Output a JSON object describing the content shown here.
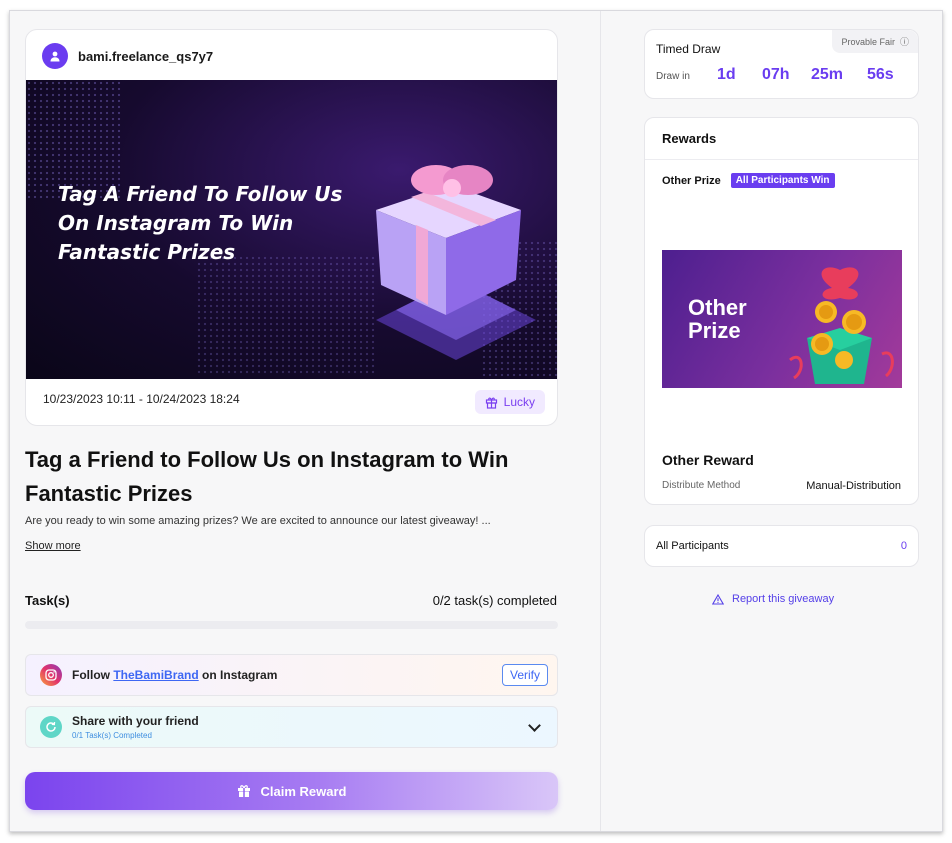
{
  "giveaway": {
    "username": "bami.freelance_qs7y7",
    "banner_text": "Tag A Friend To Follow Us On Instagram To Win Fantastic Prizes",
    "date_range": "10/23/2023 10:11 - 10/24/2023 18:24",
    "badge": "Lucky",
    "title": "Tag a Friend to Follow Us on Instagram to Win Fantastic Prizes",
    "description": "Are you ready to win some amazing prizes? We are excited to announce our latest giveaway! ...",
    "show_more": "Show more"
  },
  "tasks": {
    "label": "Task(s)",
    "completed_text": "0/2 task(s) completed",
    "progress_fraction": 0,
    "items": [
      {
        "prefix": "Follow",
        "link": "TheBamiBrand",
        "suffix": "on Instagram",
        "action": "Verify"
      },
      {
        "label": "Share with your friend",
        "sub": "0/1 Task(s) Completed"
      }
    ]
  },
  "claim_button": "Claim Reward",
  "timed_draw": {
    "title": "Timed Draw",
    "provable_fair": "Provable Fair",
    "draw_in_label": "Draw in",
    "days": "1d",
    "hours": "07h",
    "minutes": "25m",
    "seconds": "56s"
  },
  "rewards": {
    "title": "Rewards",
    "prize_label": "Other Prize",
    "prize_tag": "All Participants Win",
    "image_text_line1": "Other",
    "image_text_line2": "Prize",
    "reward_name": "Other Reward",
    "distribute_label": "Distribute Method",
    "distribute_value": "Manual-Distribution"
  },
  "participants": {
    "label": "All Participants",
    "count": "0"
  },
  "report_link": "Report this giveaway",
  "colors": {
    "accent": "#6a3df0",
    "link": "#3e67f3"
  }
}
